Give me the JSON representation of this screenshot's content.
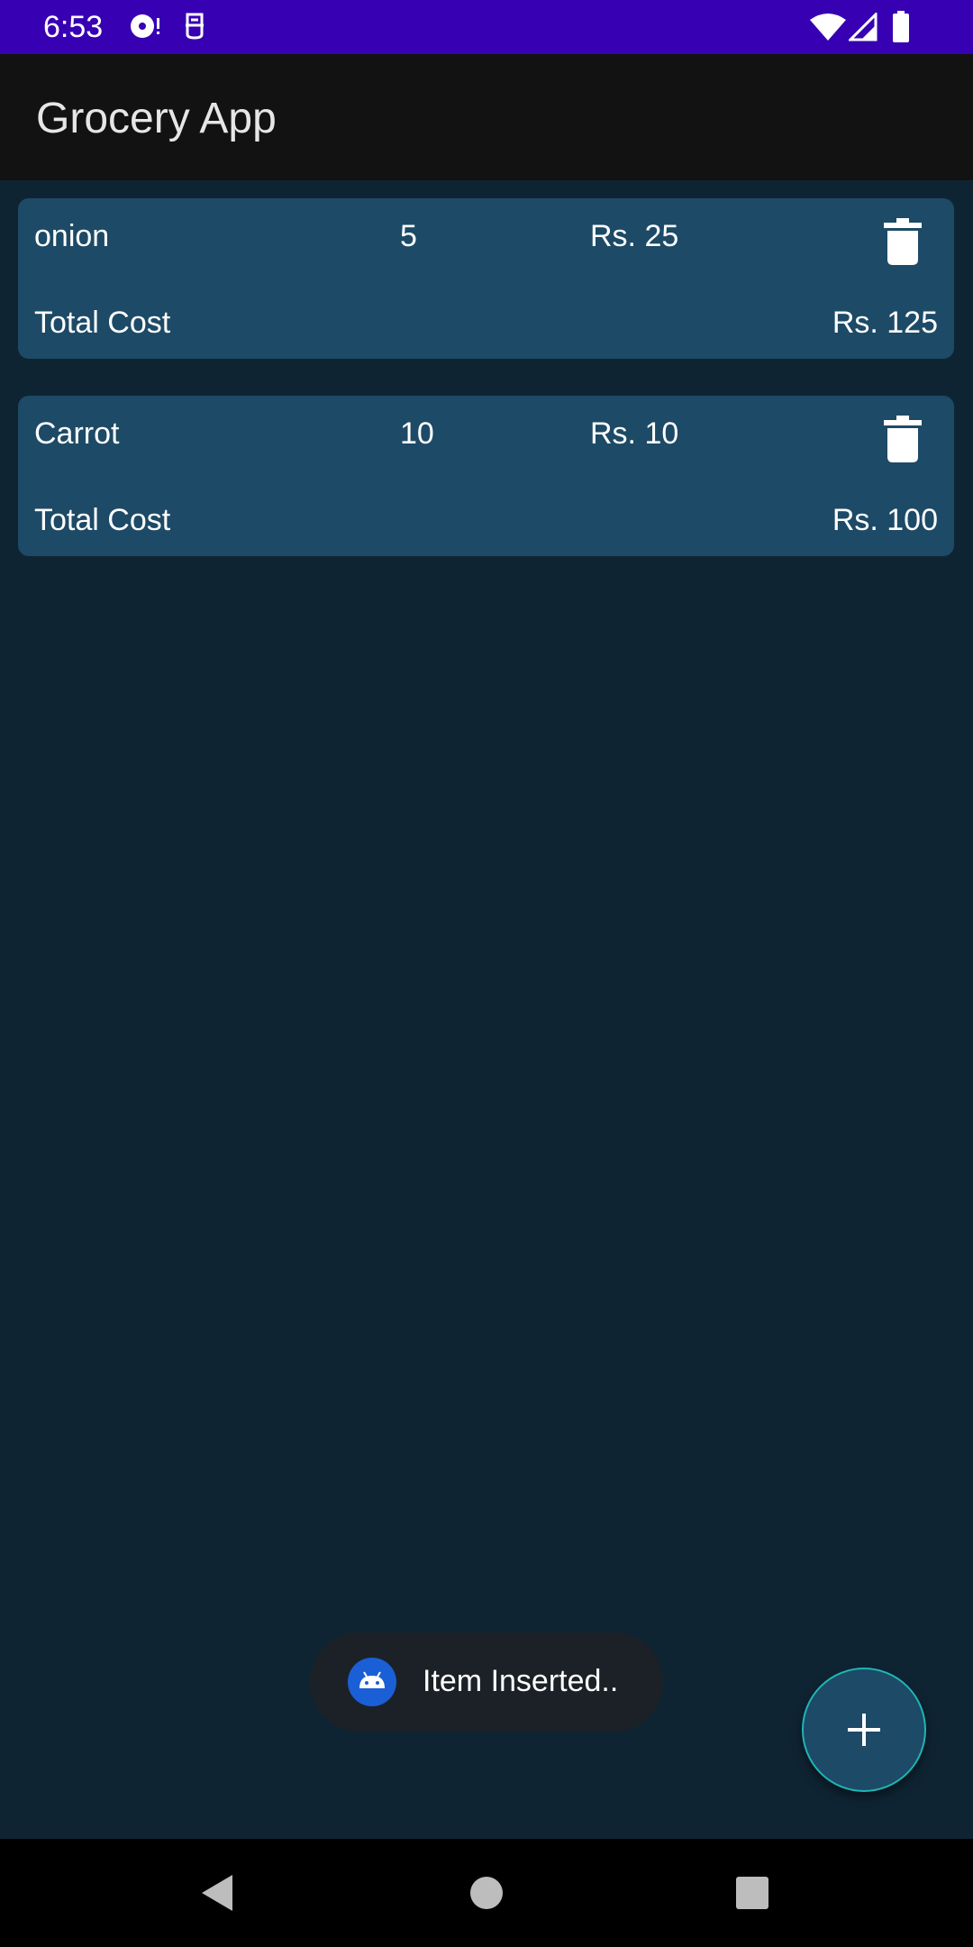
{
  "status_bar": {
    "time": "6:53",
    "left_icons": [
      "media-sync-icon",
      "no-sim-icon"
    ],
    "right_icons": [
      "wifi-icon",
      "cellular-signal-icon",
      "battery-icon"
    ],
    "background": "#3700b3"
  },
  "app_bar": {
    "title": "Grocery App",
    "background": "#121212"
  },
  "items": [
    {
      "name": "onion",
      "quantity": "5",
      "price": "Rs. 25",
      "total_label": "Total Cost",
      "total_value": "Rs. 125"
    },
    {
      "name": "Carrot",
      "quantity": "10",
      "price": "Rs. 10",
      "total_label": "Total Cost",
      "total_value": "Rs. 100"
    }
  ],
  "toast": {
    "message": "Item Inserted..",
    "icon": "android-app-icon"
  },
  "fab": {
    "icon": "plus-icon",
    "accent": "#1fb5b5"
  },
  "nav_bar": {
    "buttons": [
      "back-icon",
      "home-icon",
      "recents-icon"
    ]
  },
  "colors": {
    "background": "#0f2433",
    "card": "#1d4a66"
  }
}
